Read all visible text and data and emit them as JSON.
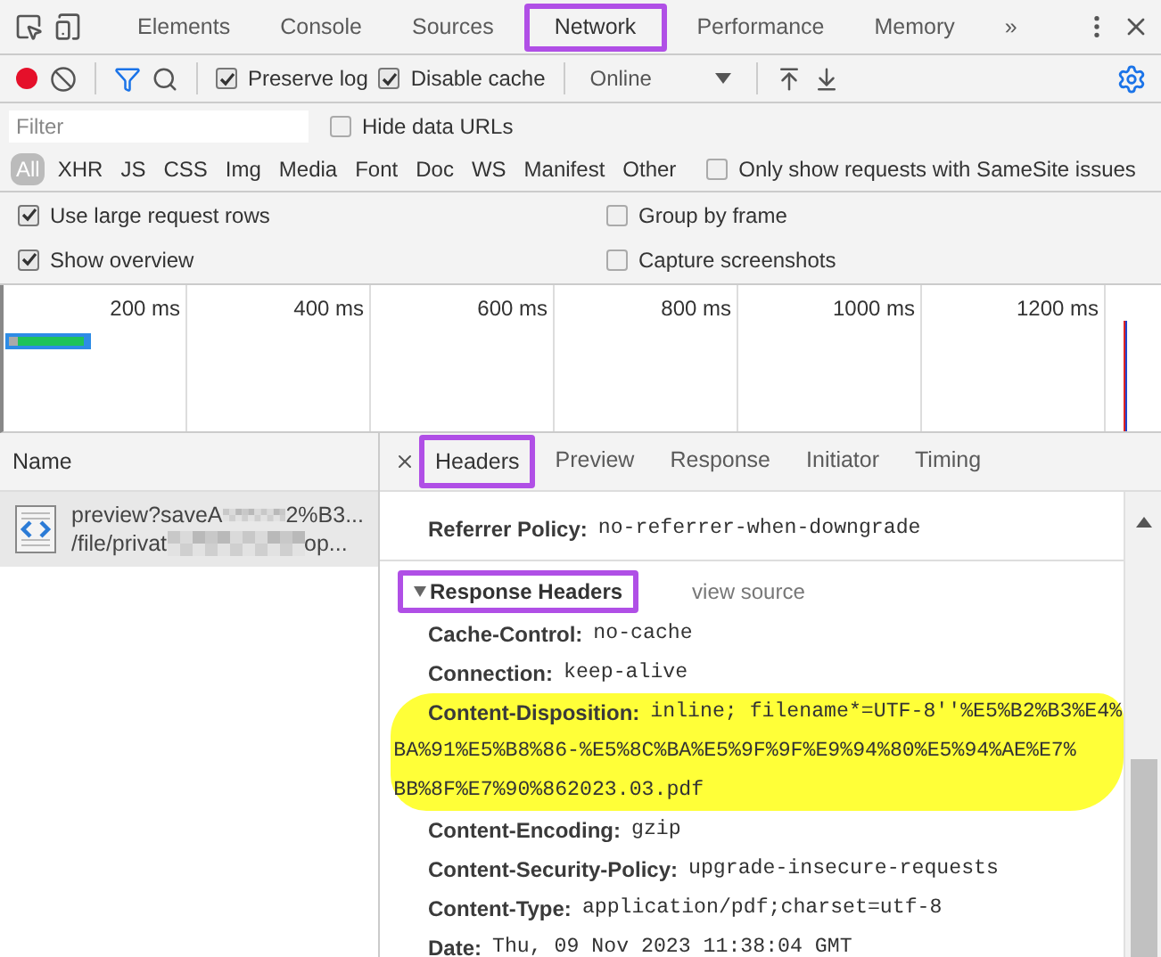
{
  "main_tabs": [
    {
      "label": "Elements",
      "selected": false,
      "annotated": false
    },
    {
      "label": "Console",
      "selected": false,
      "annotated": false
    },
    {
      "label": "Sources",
      "selected": false,
      "annotated": false
    },
    {
      "label": "Network",
      "selected": true,
      "annotated": true
    },
    {
      "label": "Performance",
      "selected": false,
      "annotated": false
    },
    {
      "label": "Memory",
      "selected": false,
      "annotated": false
    }
  ],
  "overflow": "»",
  "toolbar": {
    "recording": true,
    "filter_active": true,
    "preserve_log": {
      "label": "Preserve log",
      "checked": true
    },
    "disable_cache": {
      "label": "Disable cache",
      "checked": true
    },
    "throttling": "Online"
  },
  "filter": {
    "placeholder": "Filter",
    "hide_data_urls": {
      "label": "Hide data URLs",
      "checked": false
    }
  },
  "types": [
    {
      "label": "All",
      "selected": true
    },
    {
      "label": "XHR",
      "selected": false
    },
    {
      "label": "JS",
      "selected": false
    },
    {
      "label": "CSS",
      "selected": false
    },
    {
      "label": "Img",
      "selected": false
    },
    {
      "label": "Media",
      "selected": false
    },
    {
      "label": "Font",
      "selected": false
    },
    {
      "label": "Doc",
      "selected": false
    },
    {
      "label": "WS",
      "selected": false
    },
    {
      "label": "Manifest",
      "selected": false
    },
    {
      "label": "Other",
      "selected": false
    }
  ],
  "samesite": {
    "label": "Only show requests with SameSite issues",
    "checked": false
  },
  "settings": [
    {
      "label": "Use large request rows",
      "checked": true
    },
    {
      "label": "Group by frame",
      "checked": false
    },
    {
      "label": "Show overview",
      "checked": true
    },
    {
      "label": "Capture screenshots",
      "checked": false
    }
  ],
  "overview": {
    "ticks": [
      "200 ms",
      "400 ms",
      "600 ms",
      "800 ms",
      "1000 ms",
      "1200 ms"
    ]
  },
  "requests": {
    "column": "Name",
    "rows": [
      {
        "name_start": "preview?saveA",
        "name_end": "2%B3...",
        "path_start": "/file/privat",
        "path_end": "op...",
        "selected": true
      }
    ]
  },
  "detail_tabs": [
    {
      "label": "Headers",
      "selected": true,
      "annotated": true
    },
    {
      "label": "Preview",
      "selected": false,
      "annotated": false
    },
    {
      "label": "Response",
      "selected": false,
      "annotated": false
    },
    {
      "label": "Initiator",
      "selected": false,
      "annotated": false
    },
    {
      "label": "Timing",
      "selected": false,
      "annotated": false
    }
  ],
  "headers": {
    "referrer": {
      "name": "Referrer Policy:",
      "value": "no-referrer-when-downgrade"
    },
    "section": {
      "title": "Response Headers",
      "link": "view source",
      "annotated": true,
      "expanded": true
    },
    "rows": [
      {
        "name": "Cache-Control:",
        "value_lines": [
          "no-cache"
        ],
        "highlighted": false
      },
      {
        "name": "Connection:",
        "value_lines": [
          "keep-alive"
        ],
        "highlighted": false
      },
      {
        "name": "Content-Disposition:",
        "value_lines": [
          "inline; filename*=UTF-8''%E5%B2%B3%E4%",
          "BA%91%E5%B8%86-%E5%8C%BA%E5%9F%9F%E9%94%80%E5%94%AE%E7%",
          "BB%8F%E7%90%862023.03.pdf"
        ],
        "highlighted": true
      },
      {
        "name": "Content-Encoding:",
        "value_lines": [
          "gzip"
        ],
        "highlighted": false
      },
      {
        "name": "Content-Security-Policy:",
        "value_lines": [
          "upgrade-insecure-requests"
        ],
        "highlighted": false
      },
      {
        "name": "Content-Type:",
        "value_lines": [
          "application/pdf;charset=utf-8"
        ],
        "highlighted": false
      },
      {
        "name": "Date:",
        "value_lines": [
          "Thu, 09 Nov 2023 11:38:04 GMT"
        ],
        "highlighted": false
      }
    ]
  }
}
